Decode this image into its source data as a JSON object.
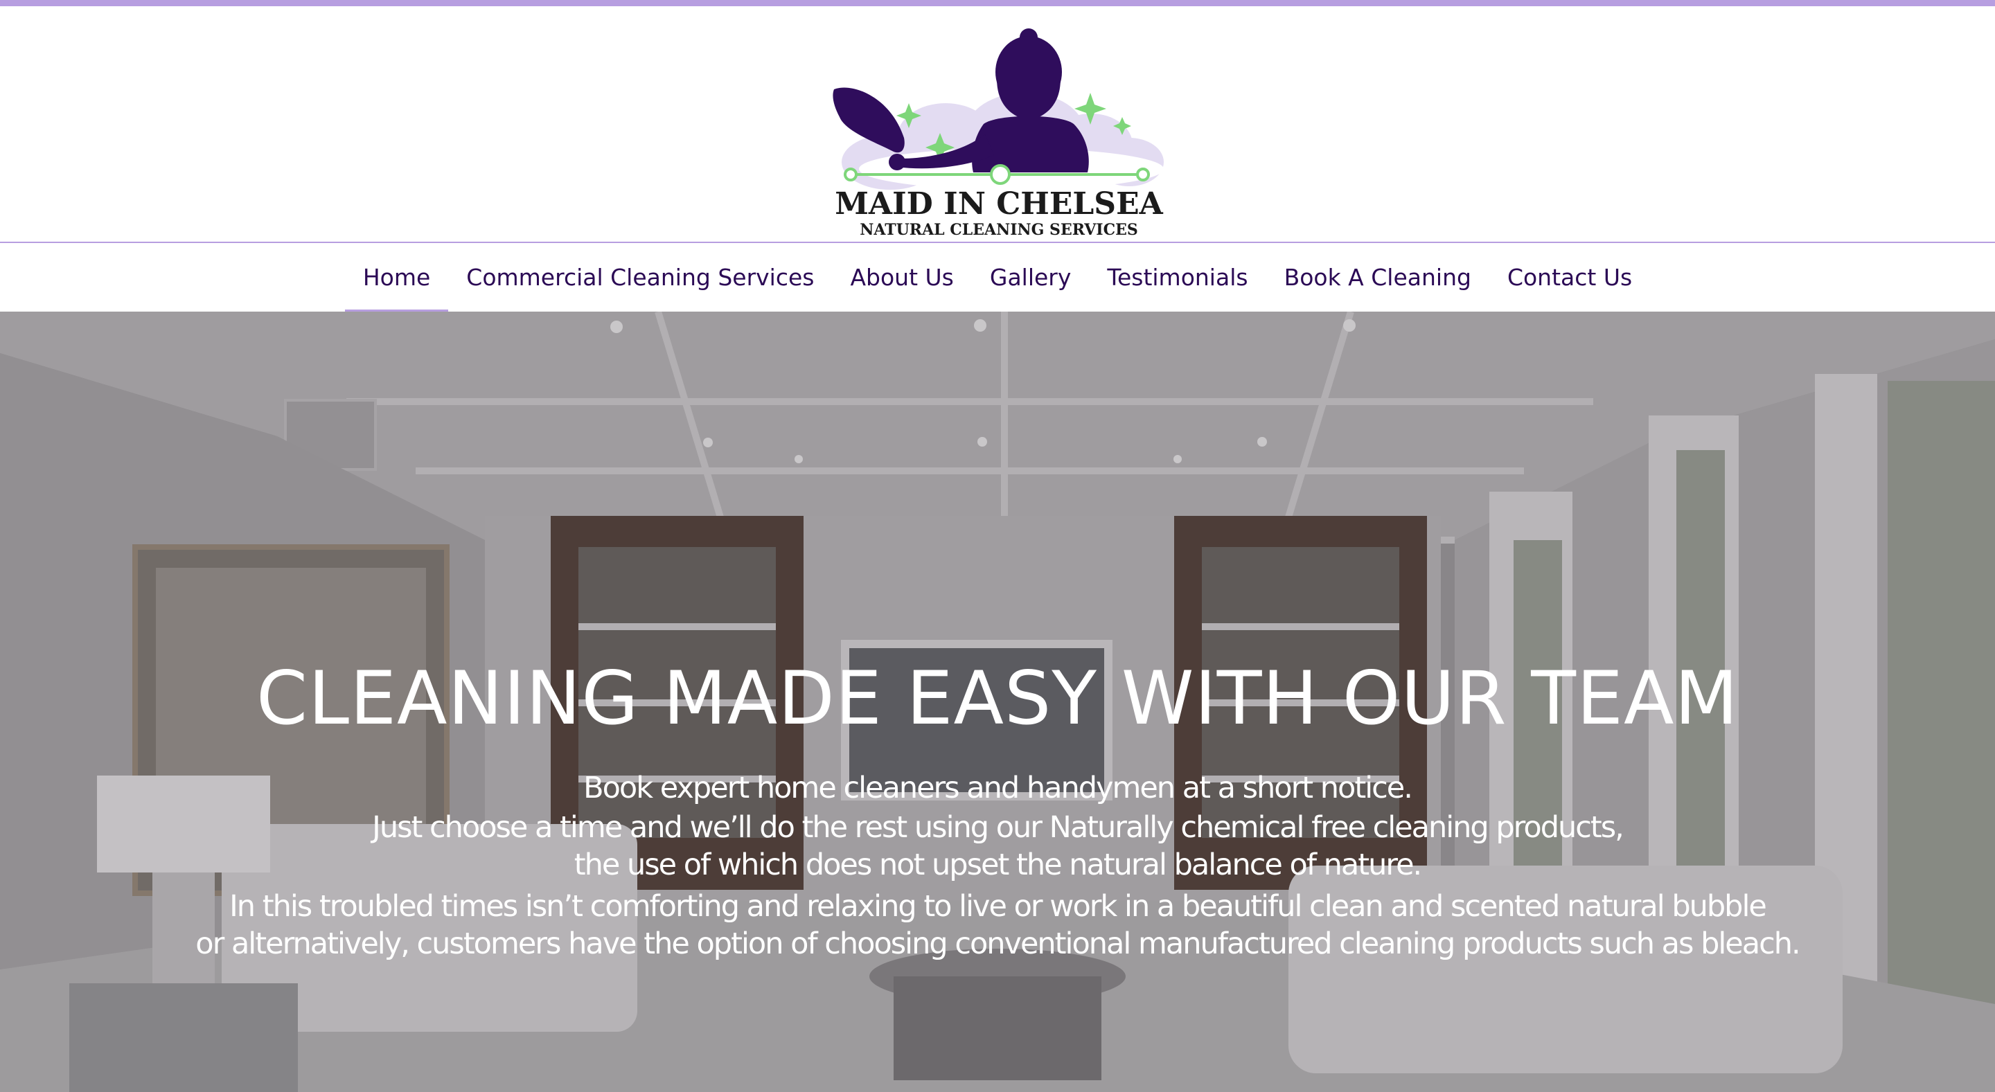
{
  "brand": {
    "name": "MAID IN CHELSEA",
    "tagline": "NATURAL CLEANING SERVICES",
    "colors": {
      "stripe": "#b79ee0",
      "logo_purple": "#2f0d5c",
      "logo_green": "#7ed67a",
      "logo_cloud": "#e3dcf2",
      "nav_text": "#2b0a55"
    }
  },
  "nav": {
    "items": [
      {
        "label": "Home",
        "active": true
      },
      {
        "label": "Commercial Cleaning Services",
        "active": false
      },
      {
        "label": "About Us",
        "active": false
      },
      {
        "label": "Gallery",
        "active": false
      },
      {
        "label": "Testimonials",
        "active": false
      },
      {
        "label": "Book A Cleaning",
        "active": false
      },
      {
        "label": "Contact Us",
        "active": false
      }
    ]
  },
  "hero": {
    "title": "CLEANING MADE EASY WITH OUR TEAM",
    "lines": [
      "Book expert home cleaners and handymen at a short notice.",
      "Just choose a time and we’ll do the rest using our Naturally chemical free cleaning products,",
      "the use of which does not upset the natural balance of nature.",
      "In this troubled times isn’t comforting and relaxing to live or work in a beautiful clean and scented natural bubble",
      "or alternatively, customers have the option of choosing conventional manufactured cleaning products such as bleach."
    ],
    "background": "living-room-photo"
  }
}
